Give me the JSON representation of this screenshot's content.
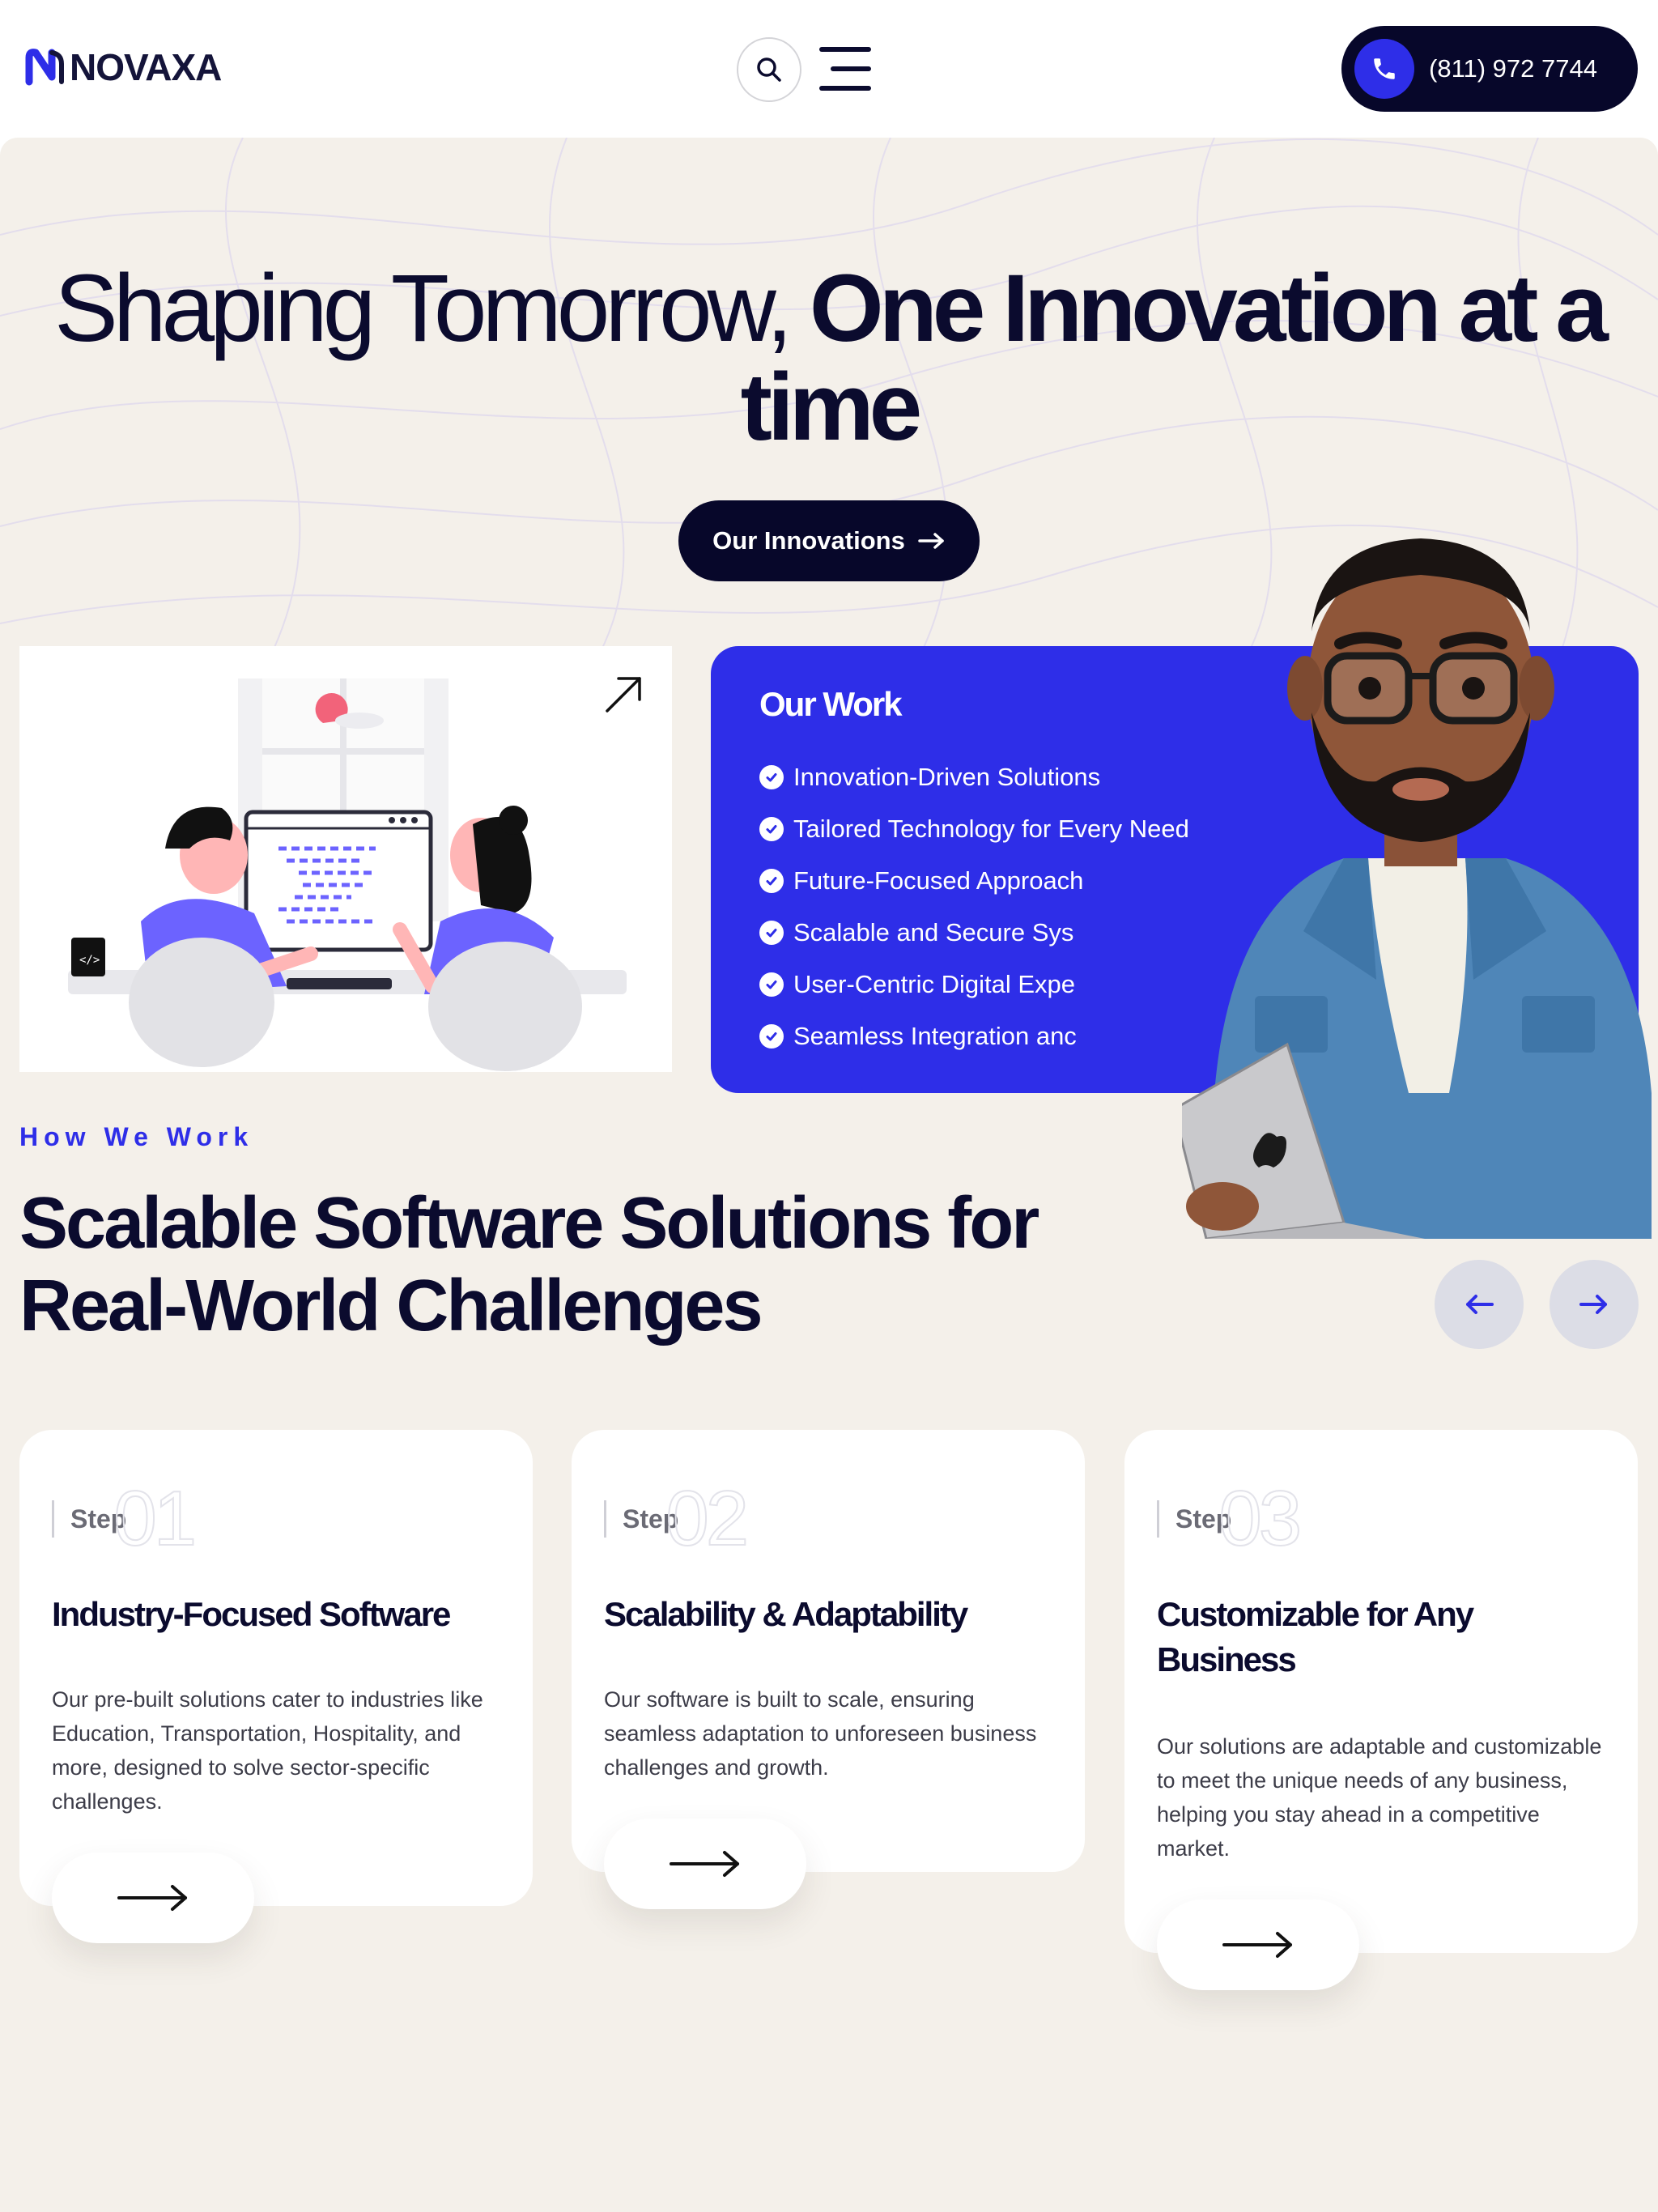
{
  "header": {
    "logo_text": "NOVAXA",
    "phone": "(811) 972 7744"
  },
  "hero": {
    "title_light": "Shaping Tomorrow, ",
    "title_bold": "One Innovation at a time",
    "cta_label": "Our Innovations"
  },
  "our_work": {
    "title": "Our Work",
    "items": [
      "Innovation-Driven Solutions",
      "Tailored Technology for Every Need",
      "Future-Focused Approach",
      "Scalable and Secure Sys",
      "User-Centric Digital Expe",
      "Seamless Integration anc"
    ]
  },
  "how_we_work": {
    "eyebrow": "How We Work",
    "title": "Scalable Software Solutions for Real-World Challenges",
    "steps": [
      {
        "label": "Step",
        "number": "01",
        "heading": "Industry-Focused Software",
        "description": "Our pre-built solutions cater to industries like Education, Transportation, Hospitality, and more, designed to solve sector-specific challenges."
      },
      {
        "label": "Step",
        "number": "02",
        "heading": "Scalability & Adaptability",
        "description": "Our software is built to scale, ensuring seamless adaptation to unforeseen business challenges and growth."
      },
      {
        "label": "Step",
        "number": "03",
        "heading": "Customizable for Any Business",
        "description": "Our solutions are adaptable and customizable to meet the unique needs of any business, helping you stay ahead in a competitive market."
      }
    ]
  },
  "colors": {
    "accent": "#2e2ee8",
    "dark": "#07072a",
    "background": "#f4f0ea"
  },
  "icons": {
    "search": "search-icon",
    "menu": "hamburger-menu-icon",
    "phone": "phone-icon",
    "arrow_right": "arrow-right-icon",
    "arrow_left": "arrow-left-icon",
    "arrow_ne": "arrow-up-right-icon",
    "check": "check-circle-icon"
  }
}
